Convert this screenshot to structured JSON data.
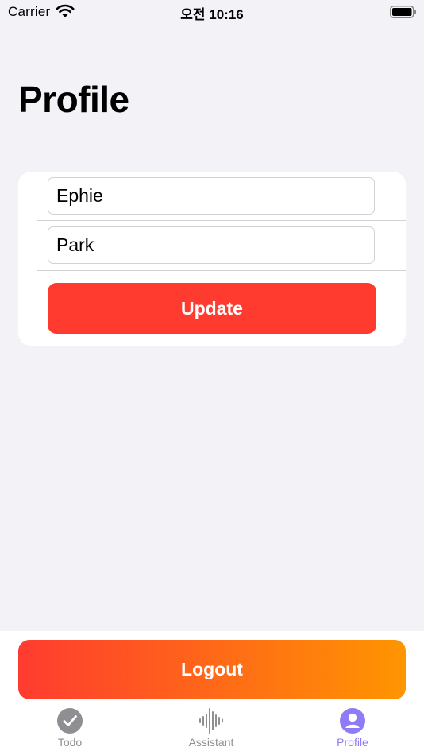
{
  "status_bar": {
    "carrier": "Carrier",
    "time": "오전 10:16",
    "wifi_icon": "wifi-icon",
    "battery_icon": "battery-icon"
  },
  "page": {
    "title": "Profile"
  },
  "form": {
    "first_name_value": "Ephie",
    "last_name_value": "Park",
    "update_label": "Update",
    "update_color": "#FF3B30"
  },
  "logout": {
    "label": "Logout",
    "gradient_start": "#FF3B30",
    "gradient_end": "#FF9500"
  },
  "tab_bar": {
    "selected": "Profile",
    "tabs": [
      {
        "label": "Todo",
        "icon": "checkmark-circle-icon"
      },
      {
        "label": "Assistant",
        "icon": "waveform-icon"
      },
      {
        "label": "Profile",
        "icon": "person-circle-icon"
      }
    ],
    "active_color": "#8E7CF7",
    "inactive_color": "#8E8E93"
  },
  "colors": {
    "background": "#F2F2F7",
    "card": "#FFFFFF"
  }
}
